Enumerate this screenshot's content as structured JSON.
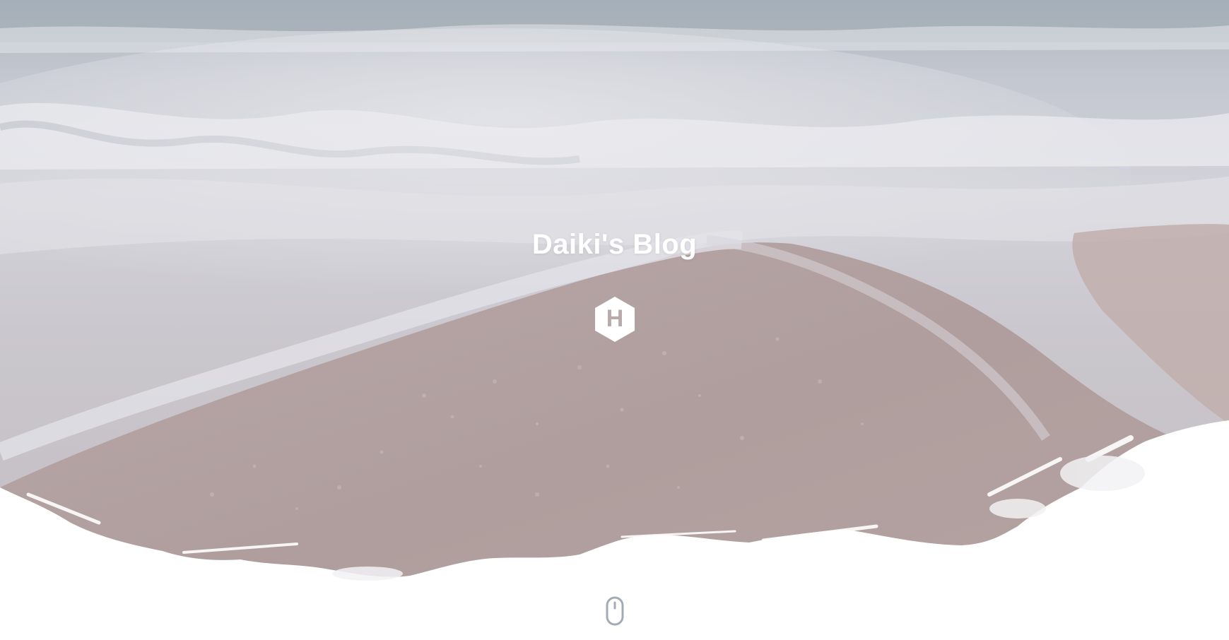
{
  "site": {
    "title": "Daiki's Blog",
    "logo_letter": "H"
  },
  "icons": {
    "logo": "hexo-logo-icon",
    "scroll": "mouse-scroll-icon"
  },
  "colors": {
    "title": "#ffffff",
    "scroll_icon": "#a3acb6",
    "page_background": "#ffffff"
  }
}
